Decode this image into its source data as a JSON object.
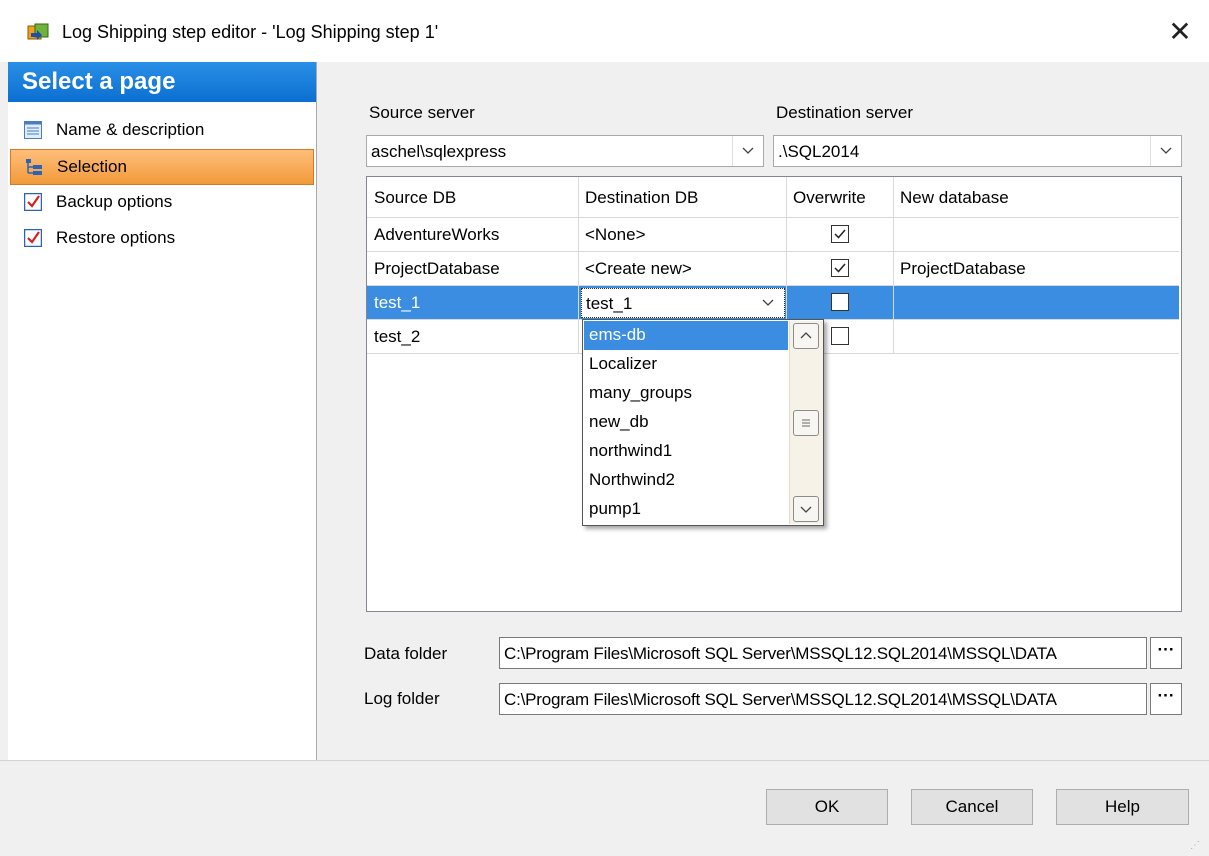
{
  "window": {
    "title": "Log Shipping step editor - 'Log Shipping step 1'",
    "close_glyph": "✕"
  },
  "sidebar": {
    "header": "Select a page",
    "items": [
      {
        "label": "Name & description",
        "icon": "list-icon",
        "selected": false
      },
      {
        "label": "Selection",
        "icon": "tree-icon",
        "selected": true
      },
      {
        "label": "Backup options",
        "icon": "checkbox-icon",
        "selected": false
      },
      {
        "label": "Restore options",
        "icon": "checkbox-icon",
        "selected": false
      }
    ]
  },
  "servers": {
    "source_label": "Source server",
    "source_value": "aschel\\sqlexpress",
    "destination_label": "Destination server",
    "destination_value": ".\\SQL2014"
  },
  "grid": {
    "columns": [
      "Source DB",
      "Destination DB",
      "Overwrite",
      "New database"
    ],
    "rows": [
      {
        "source": "AdventureWorks",
        "destination": "<None>",
        "overwrite": true,
        "new_db": ""
      },
      {
        "source": "ProjectDatabase",
        "destination": "<Create new>",
        "overwrite": true,
        "new_db": "ProjectDatabase"
      },
      {
        "source": "test_1",
        "destination": "test_1",
        "overwrite": false,
        "new_db": "",
        "selected": true
      },
      {
        "source": "test_2",
        "destination": "",
        "overwrite": false,
        "new_db": ""
      }
    ]
  },
  "dropdown": {
    "items": [
      "ems-db",
      "Localizer",
      "many_groups",
      "new_db",
      "northwind1",
      "Northwind2",
      "pump1"
    ],
    "selected": "ems-db"
  },
  "folders": {
    "data_label": "Data folder",
    "data_path": "C:\\Program Files\\Microsoft SQL Server\\MSSQL12.SQL2014\\MSSQL\\DATA",
    "log_label": "Log folder",
    "log_path": "C:\\Program Files\\Microsoft SQL Server\\MSSQL12.SQL2014\\MSSQL\\DATA",
    "browse_glyph": "···"
  },
  "buttons": {
    "ok": "OK",
    "cancel": "Cancel",
    "help": "Help"
  },
  "colors": {
    "accent": "#0b6fd1",
    "selection": "#3a8de0",
    "nav_selected": "#f29a3a"
  }
}
